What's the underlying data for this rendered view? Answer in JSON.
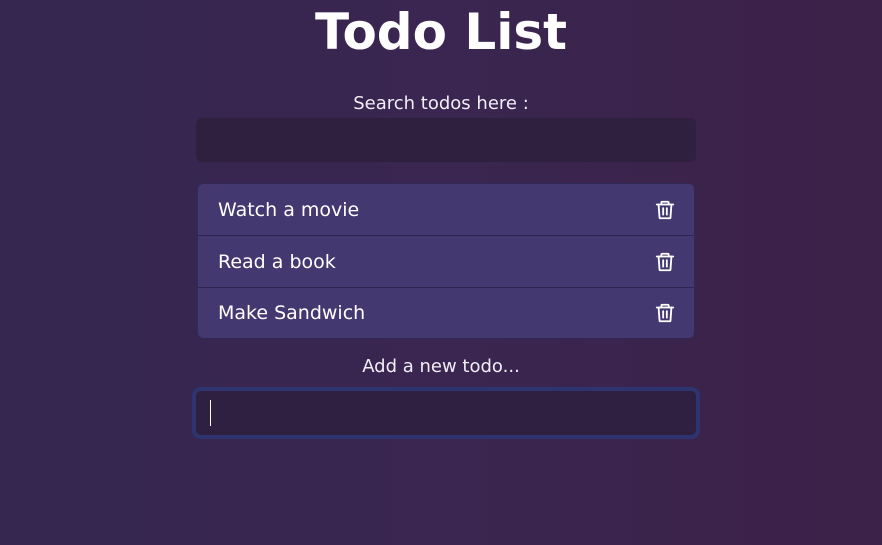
{
  "header": {
    "title": "Todo List"
  },
  "search": {
    "label": "Search todos here :",
    "value": "",
    "placeholder": ""
  },
  "todos": [
    {
      "text": "Watch a movie",
      "icon": "trash-icon"
    },
    {
      "text": "Read a book",
      "icon": "trash-icon"
    },
    {
      "text": "Make Sandwich",
      "icon": "trash-icon"
    }
  ],
  "add": {
    "label": "Add a new todo...",
    "value": "",
    "placeholder": ""
  },
  "colors": {
    "background_start": "#352750",
    "background_end": "#3c2148",
    "input_bg": "#302040",
    "item_bg": "#433970",
    "focus_border": "#2d3470"
  }
}
